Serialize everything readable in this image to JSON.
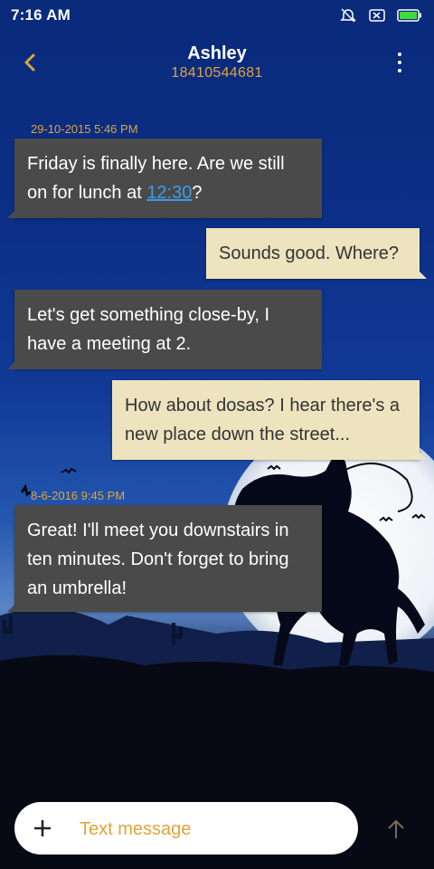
{
  "status_bar": {
    "time": "7:16 AM",
    "icons": [
      "alarm-off-icon",
      "sim-icon",
      "battery-icon"
    ]
  },
  "header": {
    "contact_name": "Ashley",
    "contact_number": "18410544681",
    "back_icon": "chevron-left-icon",
    "menu_icon": "more-vertical-icon"
  },
  "messages": [
    {
      "type": "timestamp",
      "text": "29-10-2015 5:46 PM"
    },
    {
      "type": "in",
      "text_before": "Friday is finally here. Are we still on for lunch at ",
      "link": "12:30",
      "text_after": "?"
    },
    {
      "type": "out",
      "text": "Sounds good. Where?"
    },
    {
      "type": "in",
      "text": "Let's get something close-by, I have a meeting at 2."
    },
    {
      "type": "out",
      "text": "How about dosas? I hear there's a new place down the street..."
    },
    {
      "type": "timestamp",
      "text": "8-6-2016 9:45 PM"
    },
    {
      "type": "in",
      "text": "Great! I'll meet you downstairs in ten minutes. Don't forget to bring an umbrella!"
    }
  ],
  "composer": {
    "placeholder": "Text message",
    "add_icon": "plus-icon",
    "send_icon": "send-arrow-icon"
  },
  "colors": {
    "accent": "#e0a43a",
    "incoming_bubble": "#4a4a4a",
    "outgoing_bubble": "#ede3bf",
    "link": "#3d9be9"
  }
}
